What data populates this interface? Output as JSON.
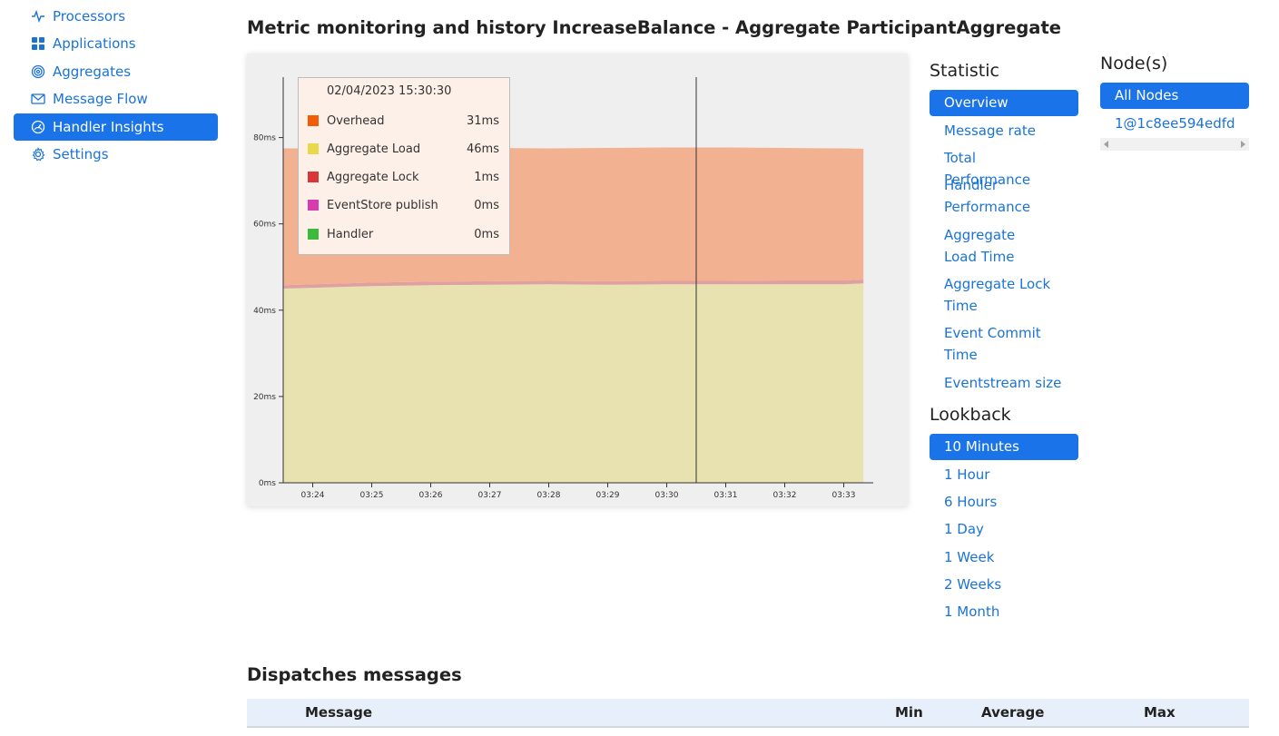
{
  "sidebar": {
    "items": [
      {
        "label": "Processors",
        "icon": "activity-icon",
        "active": false
      },
      {
        "label": "Applications",
        "icon": "apps-grid-icon",
        "active": false
      },
      {
        "label": "Aggregates",
        "icon": "target-icon",
        "active": false
      },
      {
        "label": "Message Flow",
        "icon": "envelope-icon",
        "active": false
      },
      {
        "label": "Handler Insights",
        "icon": "gauge-icon",
        "active": true
      },
      {
        "label": "Settings",
        "icon": "gear-icon",
        "active": false
      }
    ]
  },
  "page": {
    "title": "Metric monitoring and history IncreaseBalance - Aggregate ParticipantAggregate"
  },
  "tooltip": {
    "time": "02/04/2023 15:30:30",
    "rows": [
      {
        "name": "Overhead",
        "value": "31ms",
        "color": "#f25c05"
      },
      {
        "name": "Aggregate Load",
        "value": "46ms",
        "color": "#e8d84a"
      },
      {
        "name": "Aggregate Lock",
        "value": "1ms",
        "color": "#d93737"
      },
      {
        "name": "EventStore publish",
        "value": "0ms",
        "color": "#d63cb0"
      },
      {
        "name": "Handler",
        "value": "0ms",
        "color": "#3cba3c"
      }
    ]
  },
  "statistic": {
    "heading": "Statistic",
    "options": [
      "Overview",
      "Message rate",
      "Total Performance",
      "Handler Performance",
      "Aggregate Load Time",
      "Aggregate Lock Time",
      "Event Commit Time",
      "Eventstream size"
    ],
    "selected": "Overview"
  },
  "lookback": {
    "heading": "Lookback",
    "options": [
      "10 Minutes",
      "1 Hour",
      "6 Hours",
      "1 Day",
      "1 Week",
      "2 Weeks",
      "1 Month"
    ],
    "selected": "10 Minutes"
  },
  "nodes": {
    "heading": "Node(s)",
    "options": [
      "All Nodes",
      "1@1c8ee594edfd"
    ],
    "selected": "All Nodes"
  },
  "dispatches": {
    "title": "Dispatches messages",
    "columns": [
      "Message",
      "Min",
      "Average",
      "Max"
    ]
  },
  "chart_data": {
    "type": "area",
    "stacked": true,
    "x_ticks": [
      "03:24",
      "03:25",
      "03:26",
      "03:27",
      "03:28",
      "03:29",
      "03:30",
      "03:31",
      "03:32",
      "03:33"
    ],
    "y_ticks": [
      "0ms",
      "20ms",
      "40ms",
      "60ms",
      "80ms"
    ],
    "ylim": [
      0,
      94
    ],
    "crosshair_x": "03:30:30",
    "x": [
      "03:23:30",
      "03:24:00",
      "03:25:00",
      "03:26:00",
      "03:27:00",
      "03:28:00",
      "03:29:00",
      "03:30:00",
      "03:31:00",
      "03:32:00",
      "03:33:00",
      "03:33:20"
    ],
    "series": [
      {
        "name": "Aggregate Load",
        "color": "#e8e2b0",
        "values": [
          45.0,
          45.2,
          45.6,
          45.8,
          45.9,
          46.0,
          45.9,
          46.0,
          46.0,
          46.0,
          46.0,
          46.2
        ]
      },
      {
        "name": "Aggregate Lock",
        "color": "#e0a0a0",
        "values": [
          0.8,
          0.8,
          0.8,
          0.8,
          0.8,
          0.8,
          0.8,
          0.8,
          0.8,
          0.9,
          0.9,
          0.9
        ]
      },
      {
        "name": "EventStore publish",
        "color": "#d8a0c8",
        "values": [
          0,
          0,
          0,
          0,
          0,
          0,
          0,
          0,
          0,
          0,
          0,
          0
        ]
      },
      {
        "name": "Handler",
        "color": "#a0d0a0",
        "values": [
          0,
          0,
          0,
          0,
          0,
          0,
          0,
          0,
          0,
          0,
          0,
          0
        ]
      },
      {
        "name": "Overhead",
        "color": "#f2b190",
        "values": [
          31.7,
          31.5,
          31.2,
          31.0,
          30.9,
          30.7,
          30.9,
          30.9,
          30.9,
          30.7,
          30.6,
          30.3
        ]
      }
    ]
  }
}
